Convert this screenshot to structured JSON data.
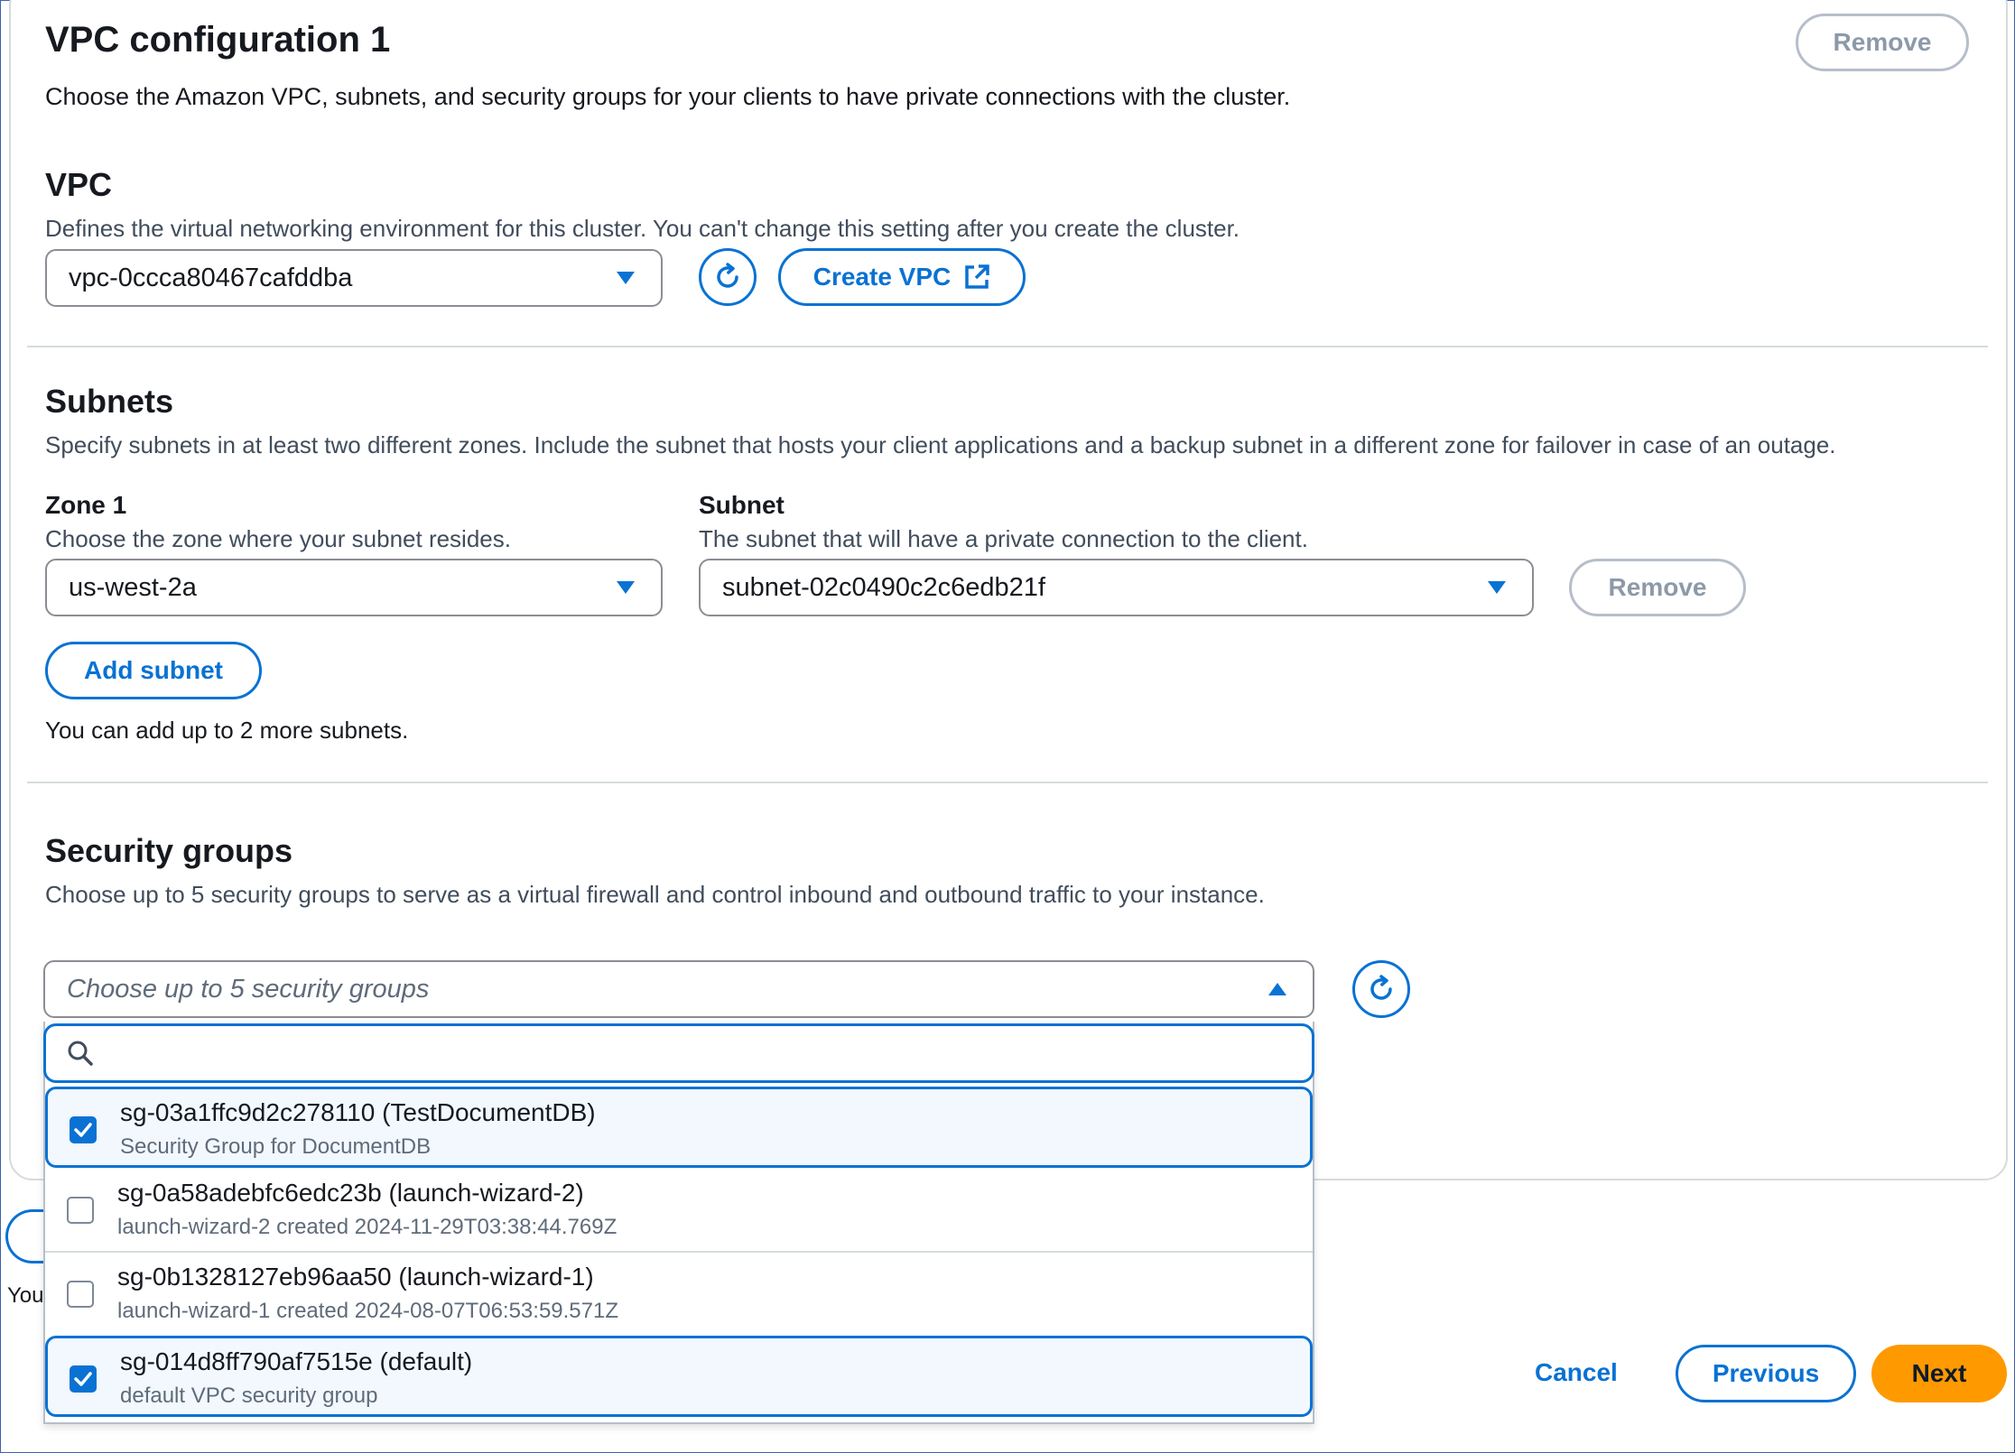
{
  "vpc_config": {
    "title": "VPC configuration 1",
    "description": "Choose the Amazon VPC, subnets, and security groups for your clients to have private connections with the cluster.",
    "remove_label": "Remove"
  },
  "vpc": {
    "heading": "VPC",
    "description": "Defines the virtual networking environment for this cluster. You can't change this setting after you create the cluster.",
    "selected": "vpc-0ccca80467cafddba",
    "create_label": "Create VPC"
  },
  "subnets": {
    "heading": "Subnets",
    "description": "Specify subnets in at least two different zones. Include the subnet that hosts your client applications and a backup subnet in a different zone for failover in case of an outage.",
    "zone_label": "Zone 1",
    "zone_hint": "Choose the zone where your subnet resides.",
    "zone_value": "us-west-2a",
    "subnet_label": "Subnet",
    "subnet_hint": "The subnet that will have a private connection to the client.",
    "subnet_value": "subnet-02c0490c2c6edb21f",
    "remove_label": "Remove",
    "add_label": "Add subnet",
    "limit_note": "You can add up to 2 more subnets."
  },
  "security_groups": {
    "heading": "Security groups",
    "description": "Choose up to 5 security groups to serve as a virtual firewall and control inbound and outbound traffic to your instance.",
    "placeholder": "Choose up to 5 security groups",
    "search_value": "",
    "options": [
      {
        "name": "sg-03a1ffc9d2c278110 (TestDocumentDB)",
        "description": "Security Group for DocumentDB",
        "checked": true
      },
      {
        "name": "sg-0a58adebfc6edc23b (launch-wizard-2)",
        "description": "launch-wizard-2 created 2024-11-29T03:38:44.769Z",
        "checked": false
      },
      {
        "name": "sg-0b1328127eb96aa50 (launch-wizard-1)",
        "description": "launch-wizard-1 created 2024-08-07T06:53:59.571Z",
        "checked": false
      },
      {
        "name": "sg-014d8ff790af7515e (default)",
        "description": "default VPC security group",
        "checked": true
      }
    ]
  },
  "behind_partial_text": "You",
  "footer": {
    "cancel_label": "Cancel",
    "previous_label": "Previous",
    "next_label": "Next"
  },
  "colors": {
    "accent": "#0972d3",
    "primary_button": "#ff9900",
    "selected_bg": "#f2f8fd"
  }
}
